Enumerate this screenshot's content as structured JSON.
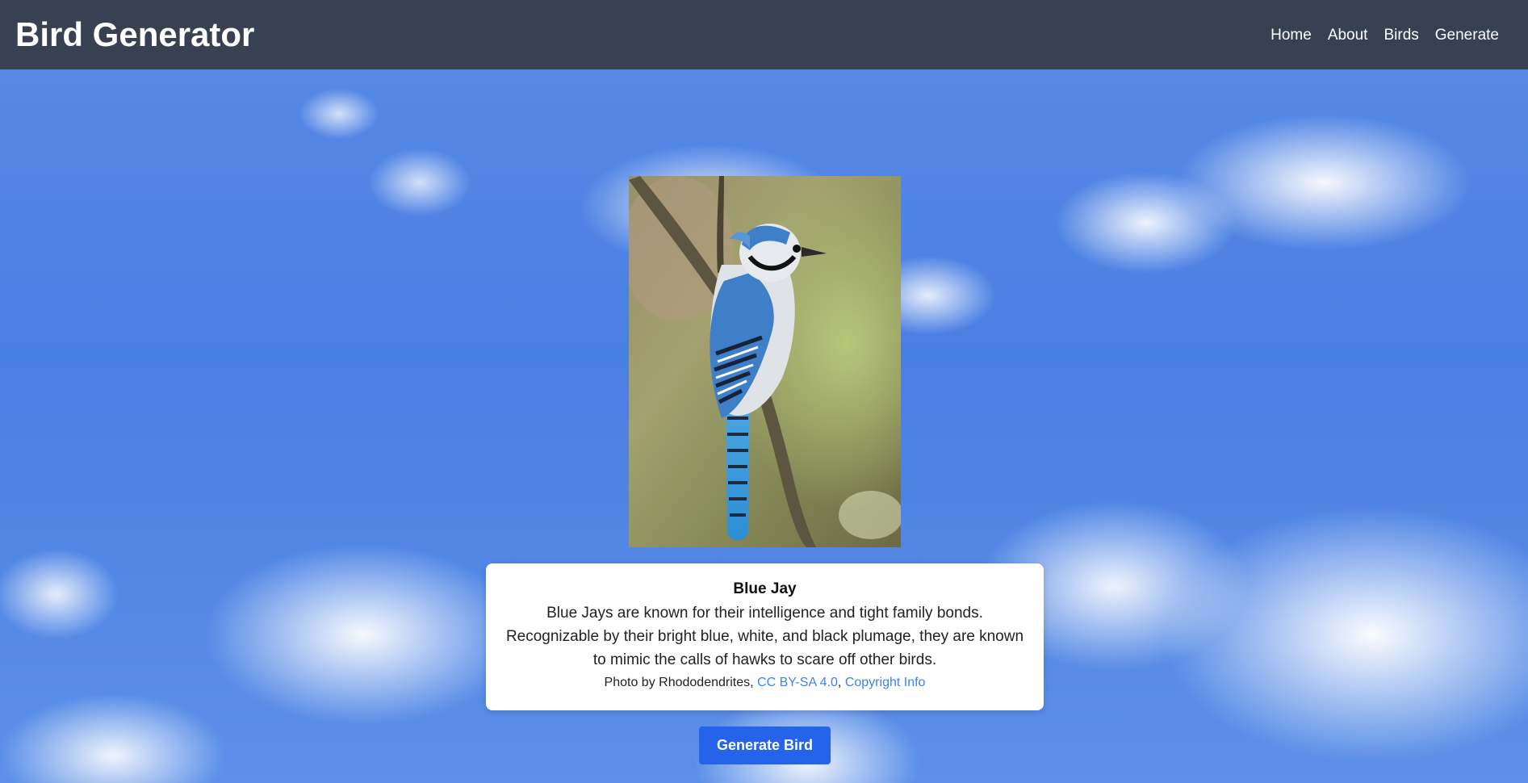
{
  "app": {
    "title": "Bird Generator"
  },
  "nav": {
    "items": [
      {
        "label": "Home"
      },
      {
        "label": "About"
      },
      {
        "label": "Birds"
      },
      {
        "label": "Generate"
      }
    ]
  },
  "bird": {
    "name": "Blue Jay",
    "description": "Blue Jays are known for their intelligence and tight family bonds. Recognizable by their bright blue, white, and black plumage, they are known to mimic the calls of hawks to scare off other birds.",
    "photo_icon": "blue-jay-photo",
    "credit_prefix": "Photo by Rhododendrites,",
    "license_link": "CC BY-SA 4.0",
    "separator": ",",
    "copyright_link": "Copyright Info"
  },
  "actions": {
    "generate_label": "Generate Bird"
  },
  "colors": {
    "navbar": "#374151",
    "button": "#2563eb",
    "link": "#3b82f6",
    "sky": "#4e82e3"
  }
}
